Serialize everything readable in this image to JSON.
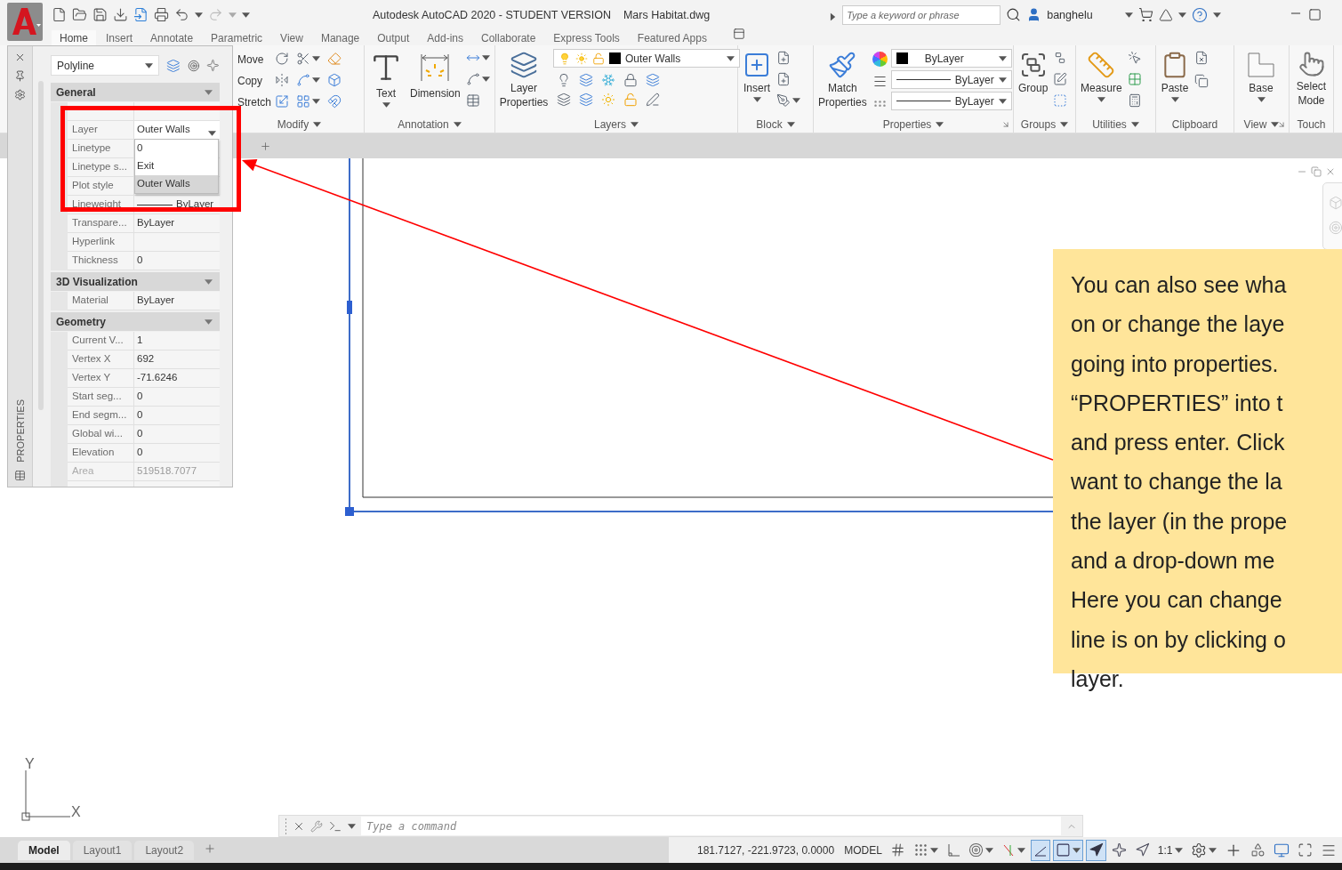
{
  "window": {
    "title": "Autodesk AutoCAD 2020 - STUDENT VERSION",
    "file_name": "Mars Habitat.dwg"
  },
  "search": {
    "placeholder": "Type a keyword or phrase"
  },
  "account": {
    "user": "banghelu"
  },
  "ribbon_tabs": [
    {
      "label": "Home",
      "selected": true
    },
    {
      "label": "Insert",
      "selected": false
    },
    {
      "label": "Annotate",
      "selected": false
    },
    {
      "label": "Parametric",
      "selected": false
    },
    {
      "label": "View",
      "selected": false
    },
    {
      "label": "Manage",
      "selected": false
    },
    {
      "label": "Output",
      "selected": false
    },
    {
      "label": "Add-ins",
      "selected": false
    },
    {
      "label": "Collaborate",
      "selected": false
    },
    {
      "label": "Express Tools",
      "selected": false
    },
    {
      "label": "Featured Apps",
      "selected": false
    }
  ],
  "ribbon_groups": [
    {
      "kind": "modify",
      "title": "Modify",
      "has_menu": true,
      "launcher": false,
      "labels": [
        "Move",
        "Copy",
        "Stretch"
      ]
    },
    {
      "kind": "annotation",
      "title": "Annotation",
      "has_menu": true,
      "launcher": false,
      "labels": [
        "Text",
        "Dimension"
      ]
    },
    {
      "kind": "layers",
      "title": "Layers",
      "has_menu": true,
      "launcher": false,
      "labels": [
        "Layer Properties"
      ],
      "current_layer": "Outer Walls"
    },
    {
      "kind": "block",
      "title": "Block",
      "has_menu": true,
      "launcher": false,
      "labels": [
        "Insert"
      ]
    },
    {
      "kind": "properties",
      "title": "Properties",
      "has_menu": true,
      "launcher": true,
      "labels": [
        "Match Properties"
      ],
      "fields": [
        "ByLayer",
        "ByLayer",
        "ByLayer"
      ]
    },
    {
      "kind": "groups",
      "title": "Groups",
      "has_menu": true,
      "launcher": false,
      "labels": [
        "Group"
      ]
    },
    {
      "kind": "utilities",
      "title": "Utilities",
      "has_menu": true,
      "launcher": false,
      "labels": [
        "Measure"
      ]
    },
    {
      "kind": "clipboard",
      "title": "Clipboard",
      "has_menu": false,
      "launcher": false,
      "labels": [
        "Paste"
      ]
    },
    {
      "kind": "view",
      "title": "View",
      "has_menu": true,
      "launcher": true,
      "labels": [
        "Base"
      ]
    },
    {
      "kind": "touch",
      "title": "Touch",
      "has_menu": false,
      "launcher": false,
      "labels": [
        "Select Mode"
      ]
    }
  ],
  "properties_palette": {
    "title": "PROPERTIES",
    "object_type": "Polyline",
    "sections": [
      {
        "title": "General",
        "expanded": true,
        "rows": [
          {
            "label": "Layer",
            "value": "Outer Walls",
            "kind": "dropdown",
            "disabled": false
          },
          {
            "label": "Linetype",
            "kind": "text",
            "disabled": false
          },
          {
            "label": "Linetype s...",
            "kind": "text",
            "disabled": false
          },
          {
            "label": "Plot style",
            "kind": "text",
            "disabled": false
          },
          {
            "label": "Lineweight",
            "value": "ByLayer",
            "kind": "lineweight",
            "disabled": false
          },
          {
            "label": "Transpare...",
            "value": "ByLayer",
            "kind": "text",
            "disabled": false
          },
          {
            "label": "Hyperlink",
            "kind": "text",
            "disabled": false
          },
          {
            "label": "Thickness",
            "value": "0",
            "kind": "text",
            "disabled": false
          }
        ]
      },
      {
        "title": "3D Visualization",
        "expanded": true,
        "rows": [
          {
            "label": "Material",
            "value": "ByLayer",
            "kind": "text",
            "disabled": false
          }
        ]
      },
      {
        "title": "Geometry",
        "expanded": true,
        "rows": [
          {
            "label": "Current V...",
            "value": "1",
            "kind": "text",
            "disabled": false
          },
          {
            "label": "Vertex X",
            "value": "692",
            "kind": "text",
            "disabled": false
          },
          {
            "label": "Vertex Y",
            "value": "-71.6246",
            "kind": "text",
            "disabled": false
          },
          {
            "label": "Start seg...",
            "value": "0",
            "kind": "text",
            "disabled": false
          },
          {
            "label": "End segm...",
            "value": "0",
            "kind": "text",
            "disabled": false
          },
          {
            "label": "Global wi...",
            "value": "0",
            "kind": "text",
            "disabled": false
          },
          {
            "label": "Elevation",
            "value": "0",
            "kind": "text",
            "disabled": false
          },
          {
            "label": "Area",
            "value": "519518.7077",
            "kind": "text",
            "disabled": true
          }
        ]
      }
    ],
    "layer_dropdown": {
      "expanded": true,
      "options": [
        {
          "label": "0",
          "selected": false
        },
        {
          "label": "Exit",
          "selected": false
        },
        {
          "label": "Outer Walls",
          "selected": true
        }
      ]
    }
  },
  "callout": {
    "lines": [
      "You can also see wha",
      "on or change the laye",
      "going into properties.",
      "“PROPERTIES” into t",
      "and press enter. Click",
      "want to change the la",
      "the layer (in the prope",
      "and a drop-down me",
      "Here you can change",
      "line is on by clicking o",
      "layer."
    ]
  },
  "ucs": {
    "x_label": "X",
    "y_label": "Y"
  },
  "command_line": {
    "placeholder": "Type a command"
  },
  "layout_tabs": [
    {
      "label": "Model",
      "selected": true
    },
    {
      "label": "Layout1",
      "selected": false
    },
    {
      "label": "Layout2",
      "selected": false
    }
  ],
  "status_bar": {
    "coordinates": "181.7127, -221.9723, 0.0000",
    "space": "MODEL",
    "tools": [
      {
        "kind": "grid",
        "active": false
      },
      {
        "kind": "snap",
        "active": false
      },
      {
        "kind": "ortho",
        "active": false
      },
      {
        "kind": "polar",
        "active": false
      },
      {
        "kind": "tracking",
        "active": false
      },
      {
        "kind": "isodraft",
        "active": true
      },
      {
        "kind": "dynamic-ucs",
        "active": true
      },
      {
        "kind": "annotation-visibility",
        "active": true
      },
      {
        "kind": "autoscale",
        "active": false
      },
      {
        "kind": "annotation-scale",
        "active": false
      },
      {
        "kind": "scale",
        "label": "1:1",
        "active": false
      },
      {
        "kind": "workspace",
        "active": false
      },
      {
        "kind": "units",
        "active": false
      },
      {
        "kind": "isolate",
        "active": false
      },
      {
        "kind": "hardware",
        "active": false
      },
      {
        "kind": "fullscreen",
        "active": false
      },
      {
        "kind": "customize",
        "active": false
      }
    ]
  }
}
